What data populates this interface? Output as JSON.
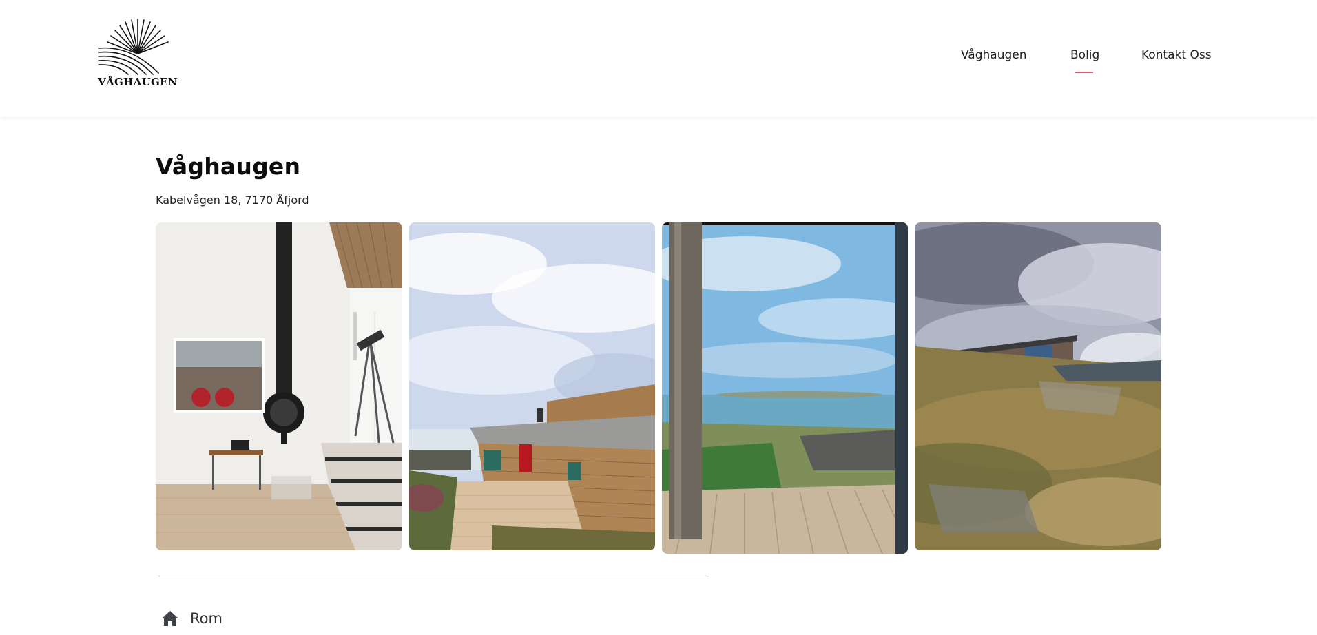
{
  "header": {
    "logo_text": "VÅGHAUGEN",
    "nav": [
      {
        "label": "Våghaugen"
      },
      {
        "label": "Bolig",
        "active": true
      },
      {
        "label": "Kontakt Oss"
      }
    ],
    "accent_color": "#e05a64"
  },
  "property": {
    "title": "Våghaugen",
    "address": "Kabelvågen 18, 7170 Åfjord"
  },
  "section": {
    "icon": "home-icon",
    "label": "Rom"
  },
  "colors": {
    "divider": "#d9303a",
    "text": "#1b1b1b"
  }
}
